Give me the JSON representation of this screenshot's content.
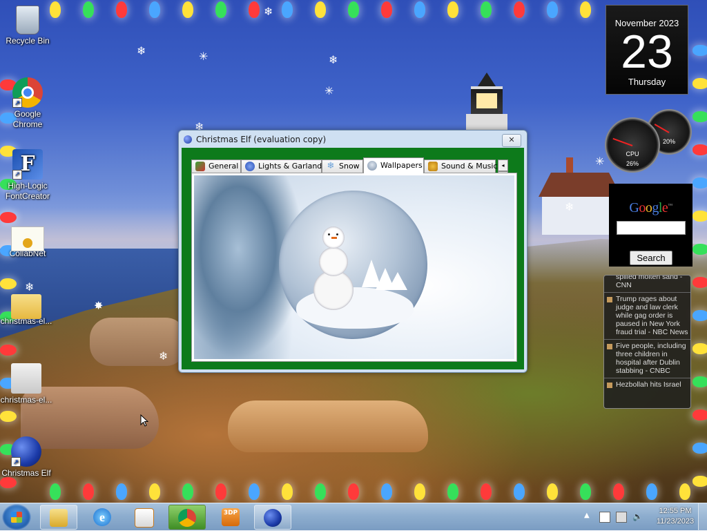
{
  "desktop": {
    "icons": [
      {
        "label": "Recycle Bin",
        "icon": "recycle-bin-icon"
      },
      {
        "label": "Google\nChrome",
        "icon": "chrome-icon"
      },
      {
        "label": "High-Logic\nFontCreator",
        "icon": "fontcreator-icon"
      },
      {
        "label": "CollabNet",
        "icon": "certificate-icon"
      },
      {
        "label": "christmas-el...",
        "icon": "zip-folder-icon"
      },
      {
        "label": "christmas-el...",
        "icon": "setup-folder-icon"
      },
      {
        "label": "Christmas Elf",
        "icon": "christmas-ball-icon"
      }
    ]
  },
  "calendar_gadget": {
    "month": "November 2023",
    "day": "23",
    "weekday": "Thursday"
  },
  "cpu_gadget": {
    "cpu_label": "CPU",
    "cpu_value": "26%",
    "mem_value": "20%"
  },
  "google_gadget": {
    "logo": "Google",
    "trademark": "™",
    "search_button": "Search",
    "search_value": ""
  },
  "news_gadget": {
    "items": [
      "spilled molten sand - CNN",
      "Trump rages about judge and law clerk while gag order is paused in New York fraud trial - NBC News",
      "Five people, including three children in hospital after Dublin stabbing - CNBC",
      "Hezbollah hits Israel"
    ]
  },
  "app_window": {
    "title": "Christmas Elf (evaluation copy)",
    "close_glyph": "✕",
    "tabs": [
      {
        "label": "General",
        "icon": "gift-icon",
        "active": false
      },
      {
        "label": "Lights & Garlands",
        "icon": "bulb-icon",
        "active": false
      },
      {
        "label": "Snow",
        "icon": "snowflake-icon",
        "active": false
      },
      {
        "label": "Wallpapers",
        "icon": "snowglobe-icon",
        "active": true
      },
      {
        "label": "Sound & Music",
        "icon": "bell-icon",
        "active": false
      }
    ],
    "scroll_left": "◂",
    "scroll_right": "▸"
  },
  "taskbar": {
    "pinned": [
      "file-explorer",
      "internet-explorer",
      "media-player",
      "chrome",
      "3dp-chip",
      "christmas-elf"
    ],
    "active_app": "chrome",
    "clock_time": "12:55 PM",
    "clock_date": "11/23/2023"
  },
  "colors": {
    "app_client_bg": "#0d7a1b",
    "taskbar": "#8eaecf",
    "desktop_sky": "#3f63c9"
  }
}
